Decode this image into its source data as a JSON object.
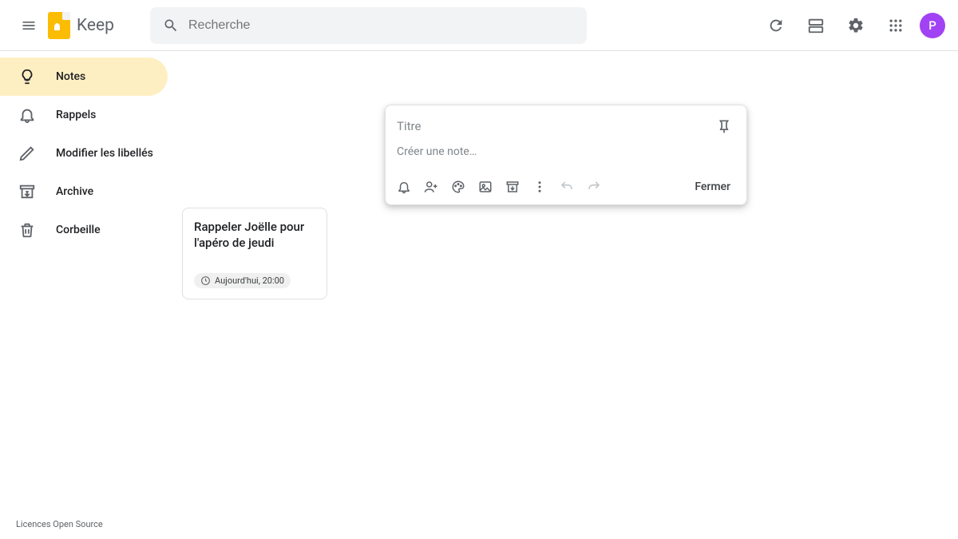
{
  "header": {
    "app_name": "Keep",
    "search_placeholder": "Recherche",
    "avatar_initial": "P"
  },
  "sidebar": {
    "items": [
      {
        "label": "Notes",
        "icon": "lightbulb",
        "active": true
      },
      {
        "label": "Rappels",
        "icon": "bell",
        "active": false
      },
      {
        "label": "Modifier les libellés",
        "icon": "pencil",
        "active": false
      },
      {
        "label": "Archive",
        "icon": "archive",
        "active": false
      },
      {
        "label": "Corbeille",
        "icon": "trash",
        "active": false
      }
    ]
  },
  "note_card": {
    "title": "Rappeler Joëlle pour l'apéro de jeudi",
    "reminder_text": "Aujourd'hui, 20:00"
  },
  "compose": {
    "title_placeholder": "Titre",
    "body_placeholder": "Créer une note…",
    "close_label": "Fermer"
  },
  "footer": {
    "open_source": "Licences Open Source"
  },
  "colors": {
    "accent": "#feefc3",
    "avatar": "#a142f4",
    "logo": "#fbbc04"
  }
}
